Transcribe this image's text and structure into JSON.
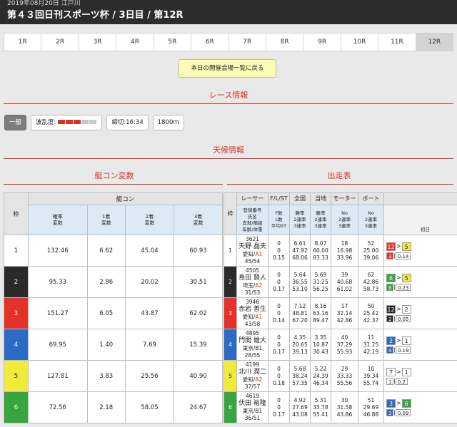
{
  "header": {
    "date_venue": "2019年08月20日 江戸川",
    "title": "第４３回日刊スポーツ杯 / 3日目 / 第12R"
  },
  "race_tabs": [
    "1R",
    "2R",
    "3R",
    "4R",
    "5R",
    "6R",
    "7R",
    "8R",
    "9R",
    "10R",
    "11R",
    "12R"
  ],
  "active_tab": "12R",
  "back_button": "本日の開催会場一覧に戻る",
  "sections": {
    "race_info": "レース情報",
    "weather": "天候情報",
    "boat_con": "艇コン変数",
    "entry": "出走表"
  },
  "race_info": {
    "class": "一般",
    "wave_label": "波乱度:",
    "wave_level": 3,
    "wave_max": 5,
    "deadline": "締切:16:34",
    "distance": "1800m"
  },
  "colors": {
    "accent_red": "#d9322a",
    "waku": [
      "#ffffff",
      "#2a2a2a",
      "#e53128",
      "#2c6bc4",
      "#f2ea3a",
      "#38a53e"
    ]
  },
  "left_table": {
    "waku_header": "枠",
    "group_header": "艇コン",
    "columns": [
      "確率\n変数",
      "1着\n変数",
      "2着\n変数",
      "3着\n変数"
    ],
    "rows": [
      {
        "waku": "1",
        "v": [
          "132.46",
          "6.62",
          "45.04",
          "60.93"
        ]
      },
      {
        "waku": "2",
        "v": [
          "95.33",
          "2.86",
          "20.02",
          "30.51"
        ]
      },
      {
        "waku": "3",
        "v": [
          "151.27",
          "6.05",
          "43.87",
          "62.02"
        ]
      },
      {
        "waku": "4",
        "v": [
          "69.95",
          "1.40",
          "7.69",
          "15.39"
        ]
      },
      {
        "waku": "5",
        "v": [
          "127.81",
          "3.83",
          "25.56",
          "40.90"
        ]
      },
      {
        "waku": "6",
        "v": [
          "72.56",
          "2.18",
          "58.05",
          "24.67"
        ]
      }
    ]
  },
  "right_table": {
    "waku_header": "枠",
    "headers": [
      "レーサー",
      "F/L/ST",
      "全国",
      "当地",
      "モーター",
      "ボート",
      "レ"
    ],
    "subheaders": [
      "登録番号\n氏名\n支部/階級\n年齢/体重",
      "F数\nL数\n平均ST",
      "勝率\n2連率\n3連率",
      "勝率\n2連率\n3連率",
      "No\n2連率\n3連率",
      "No\n2連率\n3連率",
      "初日"
    ],
    "rows": [
      {
        "waku": "1",
        "reg": "3621",
        "name": "天野 晶夫",
        "branch": "愛知/",
        "grade": "A1",
        "age_wt": "45/54",
        "fl": [
          "0",
          "0",
          "0.15"
        ],
        "nat": [
          "6.61",
          "47.92",
          "68.06"
        ],
        "loc": [
          "8.07",
          "60.00",
          "93.33"
        ],
        "motor": [
          "18",
          "16.98",
          "33.96"
        ],
        "boat": [
          "52",
          "25.00",
          "39.06"
        ],
        "exh": {
          "a": "12",
          "b": "5",
          "c": "3",
          "d": "0.14",
          "ac": "w3",
          "bc": "w5",
          "cc": "w3"
        }
      },
      {
        "waku": "2",
        "reg": "4505",
        "name": "島田 賢人",
        "branch": "埼玉/",
        "grade": "A2",
        "age_wt": "31/53",
        "fl": [
          "0",
          "0",
          "0.17"
        ],
        "nat": [
          "5.64",
          "36.55",
          "53.10"
        ],
        "loc": [
          "5.69",
          "31.25",
          "56.25"
        ],
        "motor": [
          "39",
          "40.68",
          "61.02"
        ],
        "boat": [
          "62",
          "42.86",
          "58.73"
        ],
        "exh": {
          "a": "6",
          "b": "5",
          "c": "6",
          "d": "0.23",
          "ac": "w6",
          "bc": "w5",
          "cc": "w6"
        }
      },
      {
        "waku": "3",
        "reg": "3946",
        "name": "赤岩 善生",
        "branch": "愛知/",
        "grade": "A1",
        "age_wt": "43/58",
        "fl": [
          "0",
          "0",
          "0.14"
        ],
        "nat": [
          "7.12",
          "48.81",
          "67.20"
        ],
        "loc": [
          "8.16",
          "63.16",
          "89.47"
        ],
        "motor": [
          "17",
          "32.14",
          "42.86"
        ],
        "boat": [
          "50",
          "25.42",
          "42.37"
        ],
        "exh": {
          "a": "12",
          "b": "2",
          "c": "2",
          "d": "0.05",
          "ac": "w2",
          "bc": "w1",
          "cc": "w2"
        }
      },
      {
        "waku": "4",
        "reg": "4895",
        "name": "門間 雄大",
        "branch": "東京/",
        "grade": "B1",
        "age_wt": "28/55",
        "fl": [
          "0",
          "0",
          "0.17"
        ],
        "nat": [
          "4.35",
          "20.65",
          "39.13"
        ],
        "loc": [
          "3.35",
          "10.87",
          "30.43"
        ],
        "motor": [
          "40",
          "37.29",
          "55.93"
        ],
        "boat": [
          "11",
          "31.25",
          "42.19"
        ],
        "exh": {
          "a": "2",
          "b": "1",
          "c": "4",
          "d": "0.19",
          "ac": "w4",
          "bc": "w1",
          "cc": "w4"
        }
      },
      {
        "waku": "5",
        "reg": "4199",
        "name": "北川 潤二",
        "branch": "愛知/",
        "grade": "A2",
        "age_wt": "37/57",
        "fl": [
          "0",
          "0",
          "0.18"
        ],
        "nat": [
          "5.68",
          "38.24",
          "57.35"
        ],
        "loc": [
          "5.22",
          "24.39",
          "46.34"
        ],
        "motor": [
          "29",
          "33.33",
          "55.56"
        ],
        "boat": [
          "10",
          "39.34",
          "55.74"
        ],
        "exh": {
          "a": "7",
          "b": "1",
          "c": "1",
          "d": "0.2",
          "ac": "w1",
          "bc": "w1",
          "cc": "w1"
        }
      },
      {
        "waku": "6",
        "reg": "4619",
        "name": "伏田 裕隆",
        "branch": "東京/",
        "grade": "B1",
        "age_wt": "36/51",
        "fl": [
          "0",
          "0",
          "0.17"
        ],
        "nat": [
          "4.92",
          "27.69",
          "43.08"
        ],
        "loc": [
          "5.31",
          "33.78",
          "55.41"
        ],
        "motor": [
          "30",
          "31.58",
          "43.86"
        ],
        "boat": [
          "51",
          "29.69",
          "46.88"
        ],
        "exh": {
          "a": "3",
          "b": "6",
          "c": "3",
          "d": "0.09",
          "ac": "w4",
          "bc": "w6",
          "cc": "w4"
        }
      }
    ]
  }
}
